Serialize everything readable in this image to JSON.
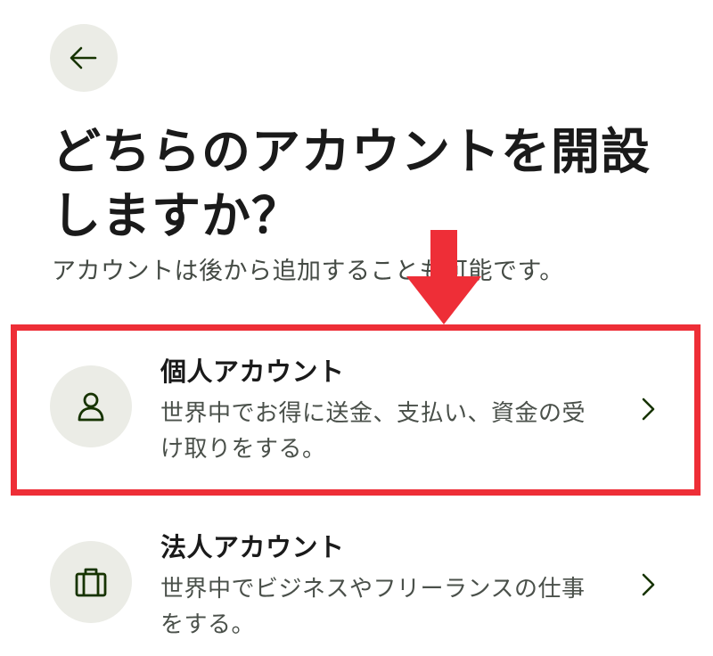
{
  "header": {
    "back_label": "←"
  },
  "title": "どちらのアカウントを開設しますか？",
  "subtitle": "アカウントは後から追加することも可能です。",
  "options": [
    {
      "title": "個人アカウント",
      "description": "世界中でお得に送金、支払い、資金の受け取りをする。",
      "icon": "person-icon"
    },
    {
      "title": "法人アカウント",
      "description": "世界中でビジネスやフリーランスの仕事をする。",
      "icon": "briefcase-icon"
    }
  ],
  "colors": {
    "icon_bg": "#ebece6",
    "icon_stroke": "#163300",
    "highlight": "#ee2e37",
    "text": "#1a1a1a"
  }
}
